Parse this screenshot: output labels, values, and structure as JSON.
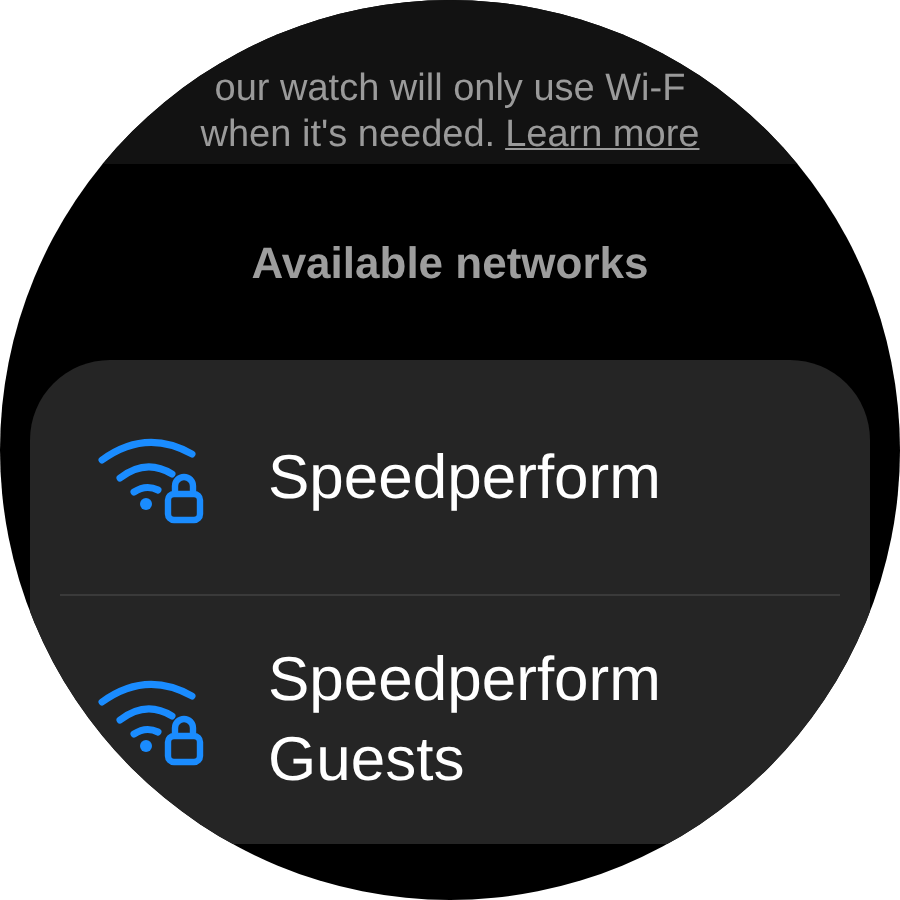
{
  "info": {
    "lines": [
      "our watch will only use Wi-F",
      "when it's needed."
    ],
    "link": "Learn more"
  },
  "section_title": "Available networks",
  "networks": [
    {
      "name": "Speedperform",
      "secured": true
    },
    {
      "name": "Speedperform Guests",
      "secured": true
    }
  ]
}
